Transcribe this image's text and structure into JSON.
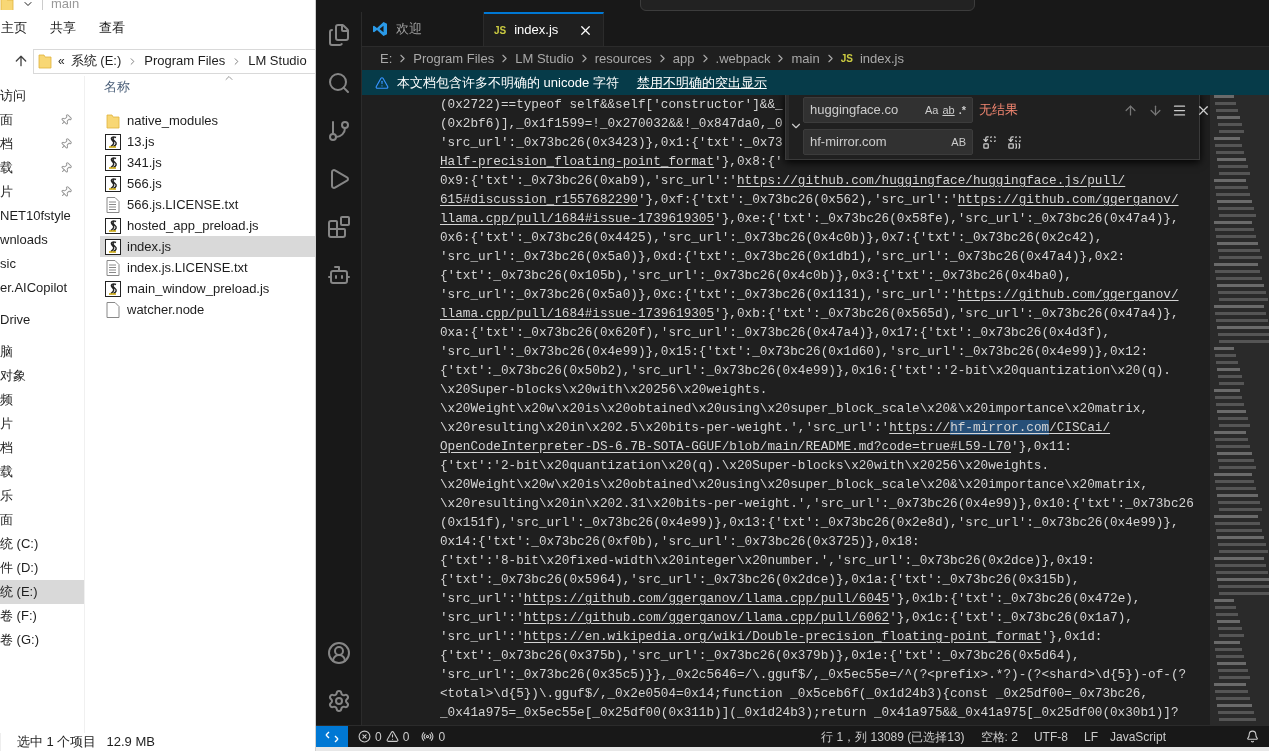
{
  "explorer": {
    "title": "main",
    "ribbon_tabs": [
      "主页",
      "共享",
      "查看"
    ],
    "address": {
      "overflow": "«",
      "parts": [
        "系统 (E:)",
        "Program Files",
        "LM Studio"
      ]
    },
    "nav_groups": [
      {
        "items": [
          {
            "label": "访问",
            "pinned": false,
            "selected": false
          },
          {
            "label": "面",
            "pinned": true,
            "selected": false
          },
          {
            "label": "档",
            "pinned": true,
            "selected": false
          },
          {
            "label": "载",
            "pinned": true,
            "selected": false
          },
          {
            "label": "片",
            "pinned": true,
            "selected": false
          },
          {
            "label": "NET10fstyle",
            "pinned": false,
            "selected": false
          },
          {
            "label": "wnloads",
            "pinned": false,
            "selected": false
          },
          {
            "label": "sic",
            "pinned": false,
            "selected": false
          },
          {
            "label": "er.AICopilot",
            "pinned": false,
            "selected": false
          }
        ]
      },
      {
        "items": [
          {
            "label": "Drive",
            "pinned": false,
            "selected": false
          }
        ]
      },
      {
        "items": [
          {
            "label": "脑",
            "pinned": false,
            "selected": false
          },
          {
            "label": "对象",
            "pinned": false,
            "selected": false
          },
          {
            "label": "频",
            "pinned": false,
            "selected": false
          },
          {
            "label": "片",
            "pinned": false,
            "selected": false
          },
          {
            "label": "档",
            "pinned": false,
            "selected": false
          },
          {
            "label": "载",
            "pinned": false,
            "selected": false
          },
          {
            "label": "乐",
            "pinned": false,
            "selected": false
          },
          {
            "label": "面",
            "pinned": false,
            "selected": false
          },
          {
            "label": "统 (C:)",
            "pinned": false,
            "selected": false
          },
          {
            "label": "件 (D:)",
            "pinned": false,
            "selected": false
          },
          {
            "label": "统 (E:)",
            "pinned": false,
            "selected": true
          },
          {
            "label": "卷 (F:)",
            "pinned": false,
            "selected": false
          },
          {
            "label": "卷 (G:)",
            "pinned": false,
            "selected": false
          }
        ]
      }
    ],
    "column_header": "名称",
    "files": [
      {
        "name": "native_modules",
        "kind": "folder",
        "selected": false
      },
      {
        "name": "13.js",
        "kind": "script",
        "selected": false
      },
      {
        "name": "341.js",
        "kind": "script",
        "selected": false
      },
      {
        "name": "566.js",
        "kind": "script",
        "selected": false
      },
      {
        "name": "566.js.LICENSE.txt",
        "kind": "text",
        "selected": false
      },
      {
        "name": "hosted_app_preload.js",
        "kind": "script",
        "selected": false
      },
      {
        "name": "index.js",
        "kind": "script",
        "selected": true
      },
      {
        "name": "index.js.LICENSE.txt",
        "kind": "text",
        "selected": false
      },
      {
        "name": "main_window_preload.js",
        "kind": "script",
        "selected": false
      },
      {
        "name": "watcher.node",
        "kind": "file",
        "selected": false
      }
    ],
    "status": {
      "selection": "选中 1 个项目",
      "size": "12.9 MB"
    }
  },
  "editor": {
    "tabs": [
      {
        "label": "欢迎",
        "kind": "welcome",
        "selected": false
      },
      {
        "label": "index.js",
        "kind": "js",
        "icon_text": "JS",
        "selected": true
      }
    ],
    "breadcrumbs": [
      {
        "label": "E:"
      },
      {
        "label": "Program Files"
      },
      {
        "label": "LM Studio"
      },
      {
        "label": "resources"
      },
      {
        "label": "app"
      },
      {
        "label": ".webpack"
      },
      {
        "label": "main"
      },
      {
        "label": "index.js",
        "icon_text": "JS"
      }
    ],
    "warning": {
      "message": "本文档包含许多不明确的 unicode 字符",
      "action": "禁用不明确的突出显示"
    },
    "code_lines": [
      [
        {
          "text": "(0x2722)==typeof self&&self['constructor']&&_",
          "kind": "code"
        }
      ],
      [
        {
          "text": "(0x2bf6)],_0x1f1599=!_0x270032&&!_0x847da0,_0",
          "kind": "code"
        }
      ],
      [
        {
          "text": "'src_url':_0x73bc26(0x3423)},0x1:{'txt':_0x73",
          "kind": "code"
        }
      ],
      [
        {
          "text": "Half-precision_floating-point_format",
          "kind": "link"
        },
        {
          "text": "'},0x8:{'",
          "kind": "code"
        }
      ],
      [
        {
          "text": "0x9:{'txt':_0x73bc26(0xab9),'src_url':'",
          "kind": "code"
        },
        {
          "text": "https://github.com/huggingface/huggingface.js/pull/",
          "kind": "link"
        }
      ],
      [
        {
          "text": "615#discussion_r1557682290",
          "kind": "link"
        },
        {
          "text": "'},0xf:{'txt':_0x73bc26(0x562),'src_url':'",
          "kind": "code"
        },
        {
          "text": "https://github.com/ggerganov/",
          "kind": "link"
        }
      ],
      [
        {
          "text": "llama.cpp/pull/1684#issue-1739619305",
          "kind": "link"
        },
        {
          "text": "'},0xe:{'txt':_0x73bc26(0x58fe),'src_url':_0x73bc26(0x47a4)},",
          "kind": "code"
        }
      ],
      [
        {
          "text": "0x6:{'txt':_0x73bc26(0x4425),'src_url':_0x73bc26(0x4c0b)},0x7:{'txt':_0x73bc26(0x2c42),",
          "kind": "code"
        }
      ],
      [
        {
          "text": "'src_url':_0x73bc26(0x5a0)},0xd:{'txt':_0x73bc26(0x1db1),'src_url':_0x73bc26(0x47a4)},0x2:",
          "kind": "code"
        }
      ],
      [
        {
          "text": "{'txt':_0x73bc26(0x105b),'src_url':_0x73bc26(0x4c0b)},0x3:{'txt':_0x73bc26(0x4ba0),",
          "kind": "code"
        }
      ],
      [
        {
          "text": "'src_url':_0x73bc26(0x5a0)},0xc:{'txt':_0x73bc26(0x1131),'src_url':'",
          "kind": "code"
        },
        {
          "text": "https://github.com/ggerganov/",
          "kind": "link"
        }
      ],
      [
        {
          "text": "llama.cpp/pull/1684#issue-1739619305",
          "kind": "link"
        },
        {
          "text": "'},0xb:{'txt':_0x73bc26(0x565d),'src_url':_0x73bc26(0x47a4)},",
          "kind": "code"
        }
      ],
      [
        {
          "text": "0xa:{'txt':_0x73bc26(0x620f),'src_url':_0x73bc26(0x47a4)},0x17:{'txt':_0x73bc26(0x4d3f),",
          "kind": "code"
        }
      ],
      [
        {
          "text": "'src_url':_0x73bc26(0x4e99)},0x15:{'txt':_0x73bc26(0x1d60),'src_url':_0x73bc26(0x4e99)},0x12:",
          "kind": "code"
        }
      ],
      [
        {
          "text": "{'txt':_0x73bc26(0x50b2),'src_url':_0x73bc26(0x4e99)},0x16:{'txt':'2-bit\\x20quantization\\x20(q).",
          "kind": "code"
        }
      ],
      [
        {
          "text": "\\x20Super-blocks\\x20with\\x20256\\x20weights.",
          "kind": "code"
        }
      ],
      [
        {
          "text": "\\x20Weight\\x20w\\x20is\\x20obtained\\x20using\\x20super_block_scale\\x20&\\x20importance\\x20matrix,",
          "kind": "code"
        }
      ],
      [
        {
          "text": "\\x20resulting\\x20in\\x202.5\\x20bits-per-weight.','src_url':'",
          "kind": "code"
        },
        {
          "text": "https://",
          "kind": "link"
        },
        {
          "text": "hf-mirror.com",
          "kind": "match"
        },
        {
          "text": "/CISCai/",
          "kind": "link"
        }
      ],
      [
        {
          "text": "OpenCodeInterpreter-DS-6.7B-SOTA-GGUF/blob/main/README.md?code=true#L59-L70",
          "kind": "link"
        },
        {
          "text": "'},0x11:",
          "kind": "code"
        }
      ],
      [
        {
          "text": "{'txt':'2-bit\\x20quantization\\x20(q).\\x20Super-blocks\\x20with\\x20256\\x20weights.",
          "kind": "code"
        }
      ],
      [
        {
          "text": "\\x20Weight\\x20w\\x20is\\x20obtained\\x20using\\x20super_block_scale\\x20&\\x20importance\\x20matrix,",
          "kind": "code"
        }
      ],
      [
        {
          "text": "\\x20resulting\\x20in\\x202.31\\x20bits-per-weight.','src_url':_0x73bc26(0x4e99)},0x10:{'txt':_0x73bc26",
          "kind": "code"
        }
      ],
      [
        {
          "text": "(0x151f),'src_url':_0x73bc26(0x4e99)},0x13:{'txt':_0x73bc26(0x2e8d),'src_url':_0x73bc26(0x4e99)},",
          "kind": "code"
        }
      ],
      [
        {
          "text": "0x14:{'txt':_0x73bc26(0xf0b),'src_url':_0x73bc26(0x3725)},0x18:",
          "kind": "code"
        }
      ],
      [
        {
          "text": "{'txt':'8-bit\\x20fixed-width\\x20integer\\x20number.','src_url':_0x73bc26(0x2dce)},0x19:",
          "kind": "code"
        }
      ],
      [
        {
          "text": "{'txt':_0x73bc26(0x5964),'src_url':_0x73bc26(0x2dce)},0x1a:{'txt':_0x73bc26(0x315b),",
          "kind": "code"
        }
      ],
      [
        {
          "text": "'src_url':'",
          "kind": "code"
        },
        {
          "text": "https://github.com/ggerganov/llama.cpp/pull/6045",
          "kind": "link"
        },
        {
          "text": "'},0x1b:{'txt':_0x73bc26(0x472e),",
          "kind": "code"
        }
      ],
      [
        {
          "text": "'src_url':'",
          "kind": "code"
        },
        {
          "text": "https://github.com/ggerganov/llama.cpp/pull/6062",
          "kind": "link"
        },
        {
          "text": "'},0x1c:{'txt':_0x73bc26(0x1a7),",
          "kind": "code"
        }
      ],
      [
        {
          "text": "'src_url':'",
          "kind": "code"
        },
        {
          "text": "https://en.wikipedia.org/wiki/Double-precision_floating-point_format",
          "kind": "link"
        },
        {
          "text": "'},0x1d:",
          "kind": "code"
        }
      ],
      [
        {
          "text": "{'txt':_0x73bc26(0x375b),'src_url':_0x73bc26(0x379b)},0x1e:{'txt':_0x73bc26(0x5d64),",
          "kind": "code"
        }
      ],
      [
        {
          "text": "'src_url':_0x73bc26(0x35c5)}},_0x2c5646=/\\.gguf$/,_0x5ec55e=/^(?<prefix>.*?)-(?<shard>\\d{5})-of-(?",
          "kind": "code"
        }
      ],
      [
        {
          "text": "<total>\\d{5})\\.gguf$/,_0x2e0504=0x14;function _0x5ceb6f(_0x1d24b3){const _0x25df00=_0x73bc26,",
          "kind": "code"
        }
      ],
      [
        {
          "text": "_0x41a975=_0x5ec55e[_0x25df00(0x311b)](_0x1d24b3);return _0x41a975&&_0x41a975[_0x25df00(0x30b1)]?",
          "kind": "code"
        }
      ]
    ],
    "find": {
      "find_value": "huggingface.co",
      "options": [
        {
          "text": "Aa",
          "kind": "case"
        },
        {
          "text": "ab",
          "kind": "word"
        },
        {
          "text": ".*",
          "kind": "regex"
        }
      ],
      "result": "无结果",
      "replace_value": "hf-mirror.com",
      "replace_options": [
        {
          "text": "AB",
          "kind": "case"
        }
      ]
    },
    "status_bar": {
      "errors": "0",
      "warnings": "0",
      "ports": "0",
      "cursor": "行 1，列 13089 (已选择13)",
      "indent": "空格: 2",
      "encoding": "UTF-8",
      "eol": "LF",
      "language": "JavaScript"
    }
  }
}
